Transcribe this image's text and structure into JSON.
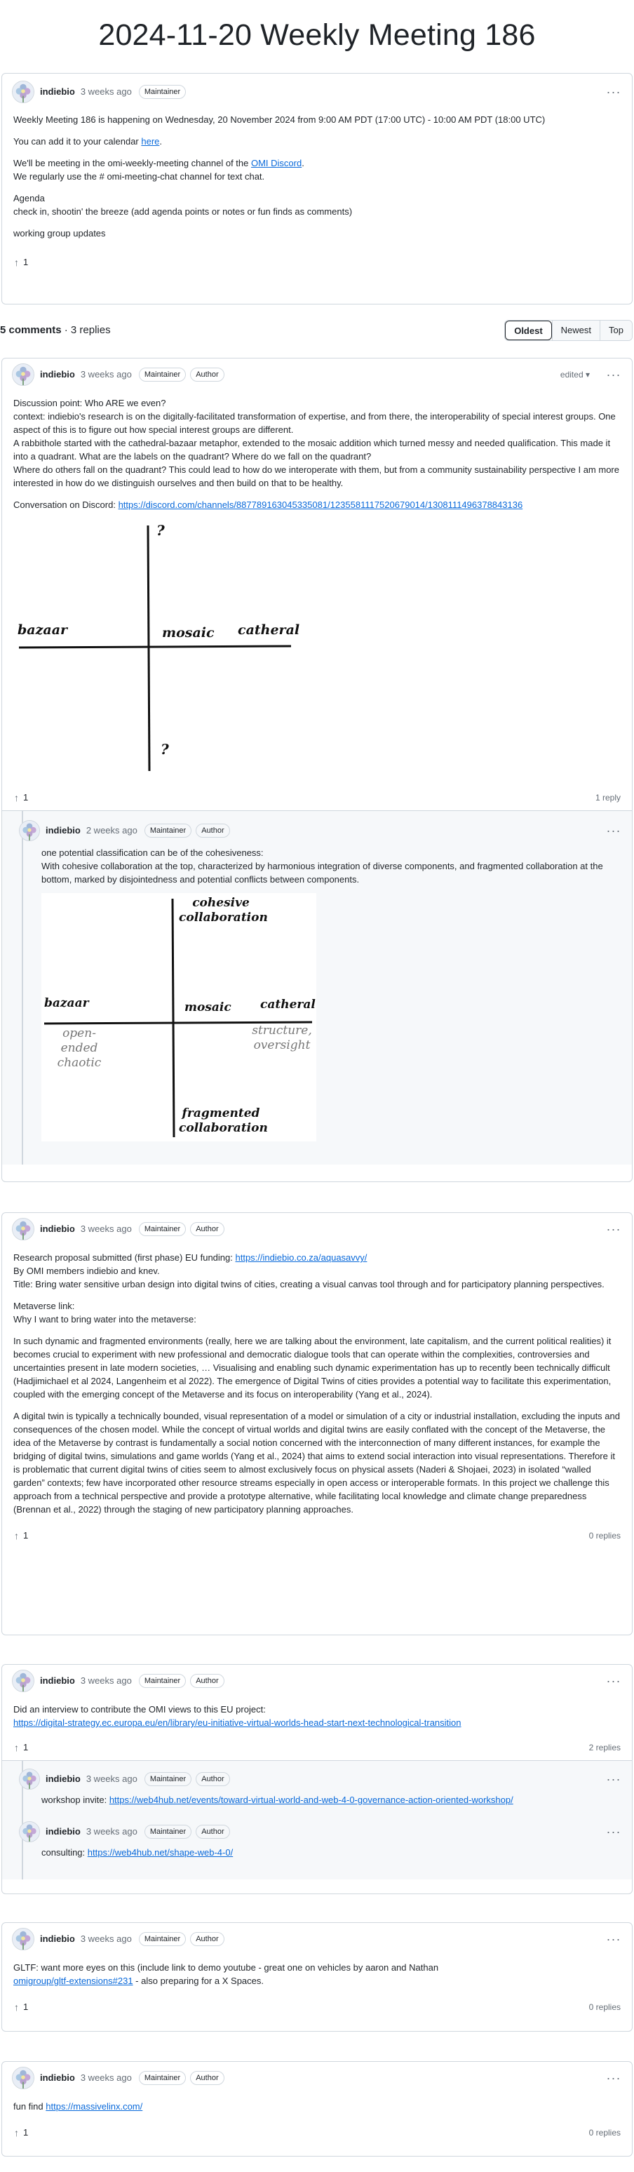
{
  "page": {
    "title": "2024-11-20 Weekly Meeting 186"
  },
  "icons": {
    "avatar": "avatar-flower-icon",
    "upvote": "arrow-up-icon",
    "more": "kebab-horizontal-icon",
    "dropdown": "triangle-down-icon"
  },
  "labels": {
    "maintainer": "Maintainer",
    "author": "Author",
    "edited": "edited",
    "more": "···",
    "arrow": "↑",
    "caret": "▾"
  },
  "post": {
    "author": "indiebio",
    "time": "3 weeks ago",
    "line1": "Weekly Meeting 186 is happening on Wednesday, 20 November 2024 from 9:00 AM PDT (17:00 UTC) - 10:00 AM PDT (18:00 UTC)",
    "line2_pre": "You can add it to your calendar ",
    "line2_link": "here",
    "line2_post": ".",
    "line3_pre": "We'll be meeting in the omi-weekly-meeting channel of the ",
    "line3_link": "OMI Discord",
    "line3_post": ".",
    "line4": "We regularly use the # omi-meeting-chat channel for text chat.",
    "agenda_title": "Agenda",
    "agenda_item": "check in, shootin' the breeze (add agenda points or notes or fun finds as comments)",
    "agenda_item2": "working group updates",
    "upvotes": "1"
  },
  "comments_bar": {
    "count": "5 comments",
    "replies": " · 3 replies",
    "sort": [
      "Oldest",
      "Newest",
      "Top"
    ]
  },
  "c1": {
    "author": "indiebio",
    "time": "3 weeks ago",
    "text": [
      "Discussion point: Who ARE we even?",
      "context: indiebio's research is on the digitally-facilitated transformation of expertise, and from there, the interoperability of special interest groups. One aspect of this is to figure out how special interest groups are different.",
      "A rabbithole started with the cathedral-bazaar metaphor, extended to the mosaic addition which turned messy and needed qualification. This made it into a quadrant. What are the labels on the quadrant? Where do we fall on the quadrant?",
      "Where do others fall on the quadrant? This could lead to how do we interoperate with them, but from a community sustainability perspective I am more interested in how do we distinguish ourselves and then build on that to be healthy."
    ],
    "conv_pre": "Conversation on Discord: ",
    "conv_link": "https://discord.com/channels/887789163045335081/1235581117520679014/1308111496378843136",
    "sketch": {
      "q_top": "?",
      "q_bottom": "?",
      "left": "bazaar",
      "center": "mosaic",
      "right": "catheral"
    },
    "upvotes": "1",
    "reply_count": "1 reply",
    "reply": {
      "author": "indiebio",
      "time": "2 weeks ago",
      "line1": "one potential classification can be of the cohesiveness:",
      "line2": "With cohesive collaboration at the top, characterized by harmonious integration of diverse components, and fragmented collaboration at the bottom, marked by disjointedness and potential conflicts between components.",
      "sketch": {
        "top": "cohesive\ncollaboration",
        "left": "bazaar",
        "center": "mosaic",
        "right": "catheral",
        "left_sub": "open-ended\nchaotic",
        "right_sub": "structure,\noversight",
        "bottom": "fragmented\ncollaboration"
      }
    }
  },
  "c2": {
    "author": "indiebio",
    "time": "3 weeks ago",
    "l1_pre": "Research proposal submitted (first phase) EU funding: ",
    "l1_link": "https://indiebio.co.za/aquasavvy/",
    "l2": "By OMI members indiebio and knev.",
    "l3": "Title: Bring water sensitive urban design into digital twins of cities, creating a visual canvas tool through and for participatory planning perspectives.",
    "l4": "Metaverse link:",
    "l5": "Why I want to bring water into the metaverse:",
    "p1": "In such dynamic and fragmented environments (really, here we are talking about the environment, late capitalism, and the current political realities) it becomes crucial to experiment with new professional and democratic dialogue tools that can operate within the complexities, controversies and uncertainties present in late modern societies, … Visualising and enabling such dynamic experimentation has up to recently been technically difficult (Hadjimichael et al 2024, Langenheim et al 2022). The emergence of Digital Twins of cities provides a potential way to facilitate this experimentation, coupled with the emerging concept of the Metaverse and its focus on interoperability (Yang et al., 2024).",
    "p2": "A digital twin is typically a technically bounded, visual representation of a model or simulation of a city or industrial installation, excluding the inputs and consequences of the chosen model. While the concept of virtual worlds and digital twins are easily conflated with the concept of the Metaverse, the idea of the Metaverse by contrast is fundamentally a social notion concerned with the interconnection of many different instances, for example the bridging of digital twins, simulations and game worlds (Yang et al., 2024) that aims to extend social interaction into visual representations. Therefore it is problematic that current digital twins of cities seem to almost exclusively focus on physical assets (Naderi & Shojaei, 2023) in isolated “walled garden” contexts; few have incorporated other resource streams especially in open access or interoperable formats. In this project we challenge this approach from a technical perspective and provide a prototype alternative, while facilitating local knowledge and climate change preparedness (Brennan et al., 2022) through the staging of new participatory planning approaches.",
    "upvotes": "1",
    "reply_count": "0 replies"
  },
  "c3": {
    "author": "indiebio",
    "time": "3 weeks ago",
    "l1": "Did an interview to contribute the OMI views to this EU project:",
    "link": "https://digital-strategy.ec.europa.eu/en/library/eu-initiative-virtual-worlds-head-start-next-technological-transition",
    "upvotes": "1",
    "reply_count": "2 replies",
    "r1": {
      "author": "indiebio",
      "time": "3 weeks ago",
      "pre": "workshop invite: ",
      "link": "https://web4hub.net/events/toward-virtual-world-and-web-4-0-governance-action-oriented-workshop/"
    },
    "r2": {
      "author": "indiebio",
      "time": "3 weeks ago",
      "pre": "consulting: ",
      "link": "https://web4hub.net/shape-web-4-0/"
    }
  },
  "c4": {
    "author": "indiebio",
    "time": "3 weeks ago",
    "l1": "GLTF: want more eyes on this (include link to demo youtube - great one on vehicles by aaron and Nathan",
    "link": "omigroup/gltf-extensions#231",
    "post": " - also preparing for a X Spaces.",
    "upvotes": "1",
    "reply_count": "0 replies"
  },
  "c5": {
    "author": "indiebio",
    "time": "3 weeks ago",
    "pre": "fun find ",
    "link": "https://massivelinx.com/",
    "upvotes": "1",
    "reply_count": "0 replies"
  }
}
